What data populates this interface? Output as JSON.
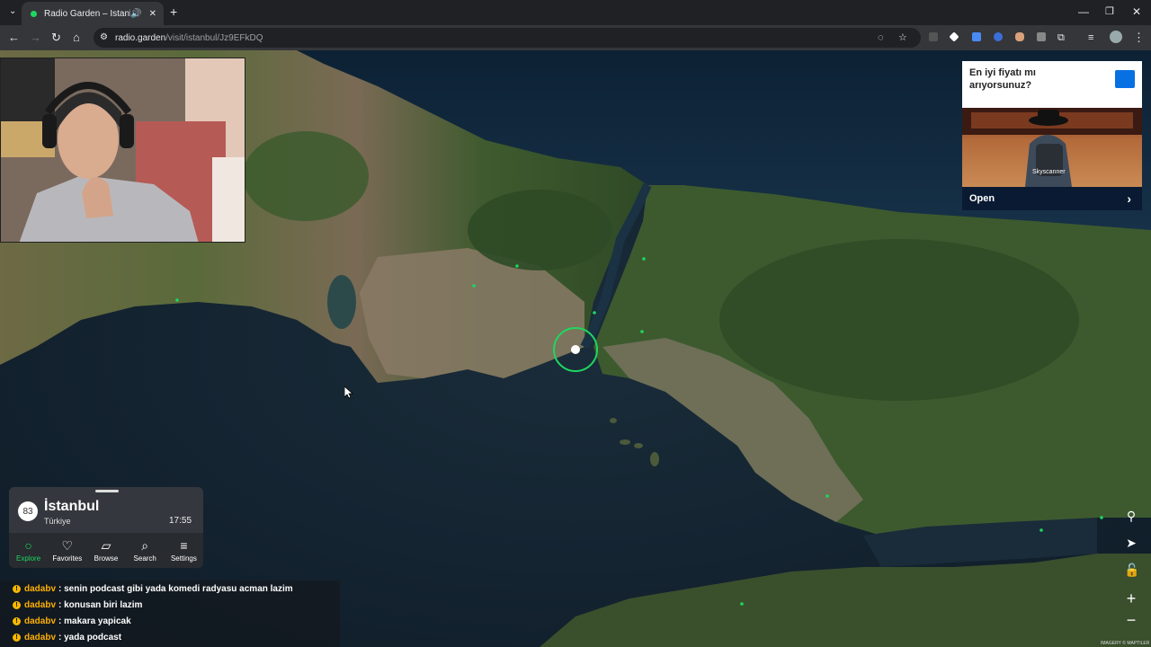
{
  "browser": {
    "tab_title": "Radio Garden – İstanbul",
    "url_host": "radio.garden",
    "url_path": "/visit/istanbul/Jz9EFkDQ"
  },
  "ad": {
    "headline": "En iyi fiyatı mı arıyorsunuz?",
    "brand": "Skyscanner",
    "cta": "Open"
  },
  "player": {
    "station_count": "83",
    "city": "İstanbul",
    "country": "Türkiye",
    "time": "17:55"
  },
  "nav": [
    {
      "label": "Explore",
      "icon": "explore-icon"
    },
    {
      "label": "Favorites",
      "icon": "heart-icon"
    },
    {
      "label": "Browse",
      "icon": "map-icon"
    },
    {
      "label": "Search",
      "icon": "search-icon"
    },
    {
      "label": "Settings",
      "icon": "menu-icon"
    }
  ],
  "chat": [
    {
      "user": "dadabv",
      "message": ": senin podcast gibi yada komedi radyasu acman lazim"
    },
    {
      "user": "dadabv",
      "message": ": konusan biri lazim"
    },
    {
      "user": "dadabv",
      "message": ": makara yapicak"
    },
    {
      "user": "dadabv",
      "message": ": yada podcast"
    }
  ],
  "attribution": "IMAGERY © MAPTILER",
  "colors": {
    "accent": "#1ed760",
    "chat_user": "#ffb000"
  }
}
